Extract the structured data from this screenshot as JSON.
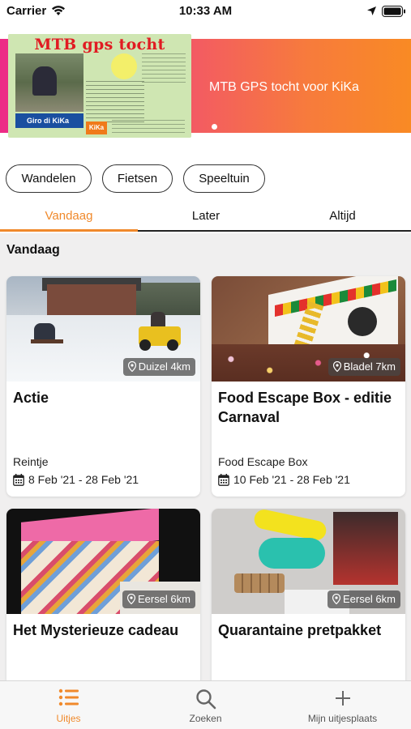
{
  "status_bar": {
    "carrier": "Carrier",
    "time": "10:33 AM"
  },
  "banner": {
    "poster_title": "MTB gps tocht",
    "poster_brand": "Giro di KiKa",
    "poster_logo": "KiKa",
    "text": "MTB GPS tocht voor KiKa",
    "gradient": [
      "#ec2a86",
      "#f98a24"
    ]
  },
  "categories": [
    "Wandelen",
    "Fietsen",
    "Speeltuin"
  ],
  "tabs": [
    {
      "label": "Vandaag",
      "active": true
    },
    {
      "label": "Later",
      "active": false
    },
    {
      "label": "Altijd",
      "active": false
    }
  ],
  "section_title": "Vandaag",
  "cards": [
    {
      "title": "Actie",
      "organizer": "Reintje",
      "dates": "8 Feb '21 - 28 Feb '21",
      "location": "Duizel 4km"
    },
    {
      "title": "Food Escape Box - editie Carnaval",
      "organizer": "Food Escape Box",
      "dates": "10 Feb '21 - 28 Feb '21",
      "location": "Bladel 7km"
    },
    {
      "title": "Het Mysterieuze cadeau",
      "organizer": "",
      "dates": "",
      "location": "Eersel 6km"
    },
    {
      "title": "Quarantaine pretpakket",
      "organizer": "",
      "dates": "",
      "location": "Eersel 6km"
    }
  ],
  "tab_bar": [
    {
      "label": "Uitjes",
      "icon": "list-icon",
      "active": true
    },
    {
      "label": "Zoeken",
      "icon": "search-icon",
      "active": false
    },
    {
      "label": "Mijn uitjesplaats",
      "icon": "plus-icon",
      "active": false
    }
  ],
  "colors": {
    "accent": "#f0892b",
    "background": "#f0efef"
  }
}
